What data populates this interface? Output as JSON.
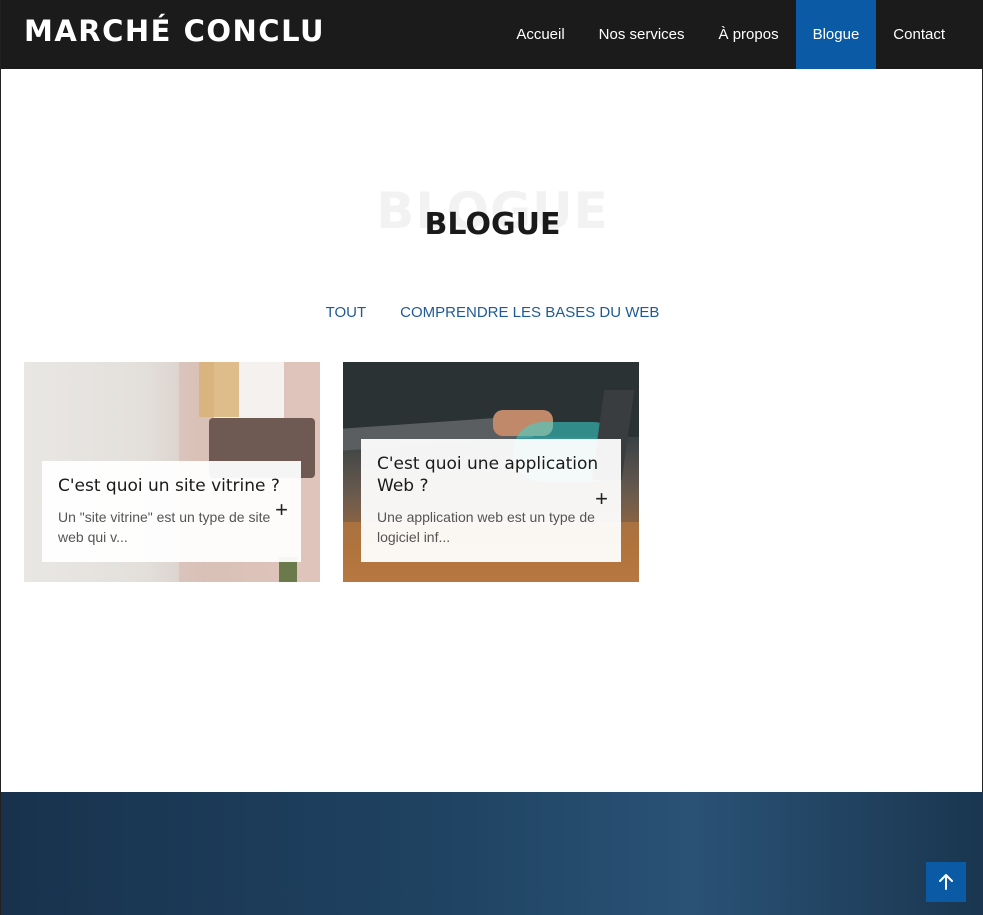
{
  "header": {
    "brand": "MARCHÉ CONCLU",
    "nav": [
      {
        "label": "Accueil"
      },
      {
        "label": "Nos services"
      },
      {
        "label": "À propos"
      },
      {
        "label": "Blogue",
        "active": true
      },
      {
        "label": "Contact"
      }
    ]
  },
  "page": {
    "title_ghost": "BLOGUE",
    "title": "BLOGUE"
  },
  "filters": [
    {
      "label": "TOUT"
    },
    {
      "label": "COMPRENDRE LES BASES DU WEB"
    }
  ],
  "posts": [
    {
      "title": "C'est quoi un site vitrine ?",
      "excerpt": "Un \"site vitrine\" est un type de site web qui v..."
    },
    {
      "title": "C'est quoi une application Web ?",
      "excerpt": "Une application web est un type de logiciel inf..."
    }
  ],
  "icons": {
    "plus": "+",
    "arrow_up": "up-arrow-icon"
  },
  "colors": {
    "header_bg": "#1b1b1b",
    "accent": "#0a5aa5",
    "filter_text": "#1f5a94",
    "footer_bg": "#1f4362"
  }
}
